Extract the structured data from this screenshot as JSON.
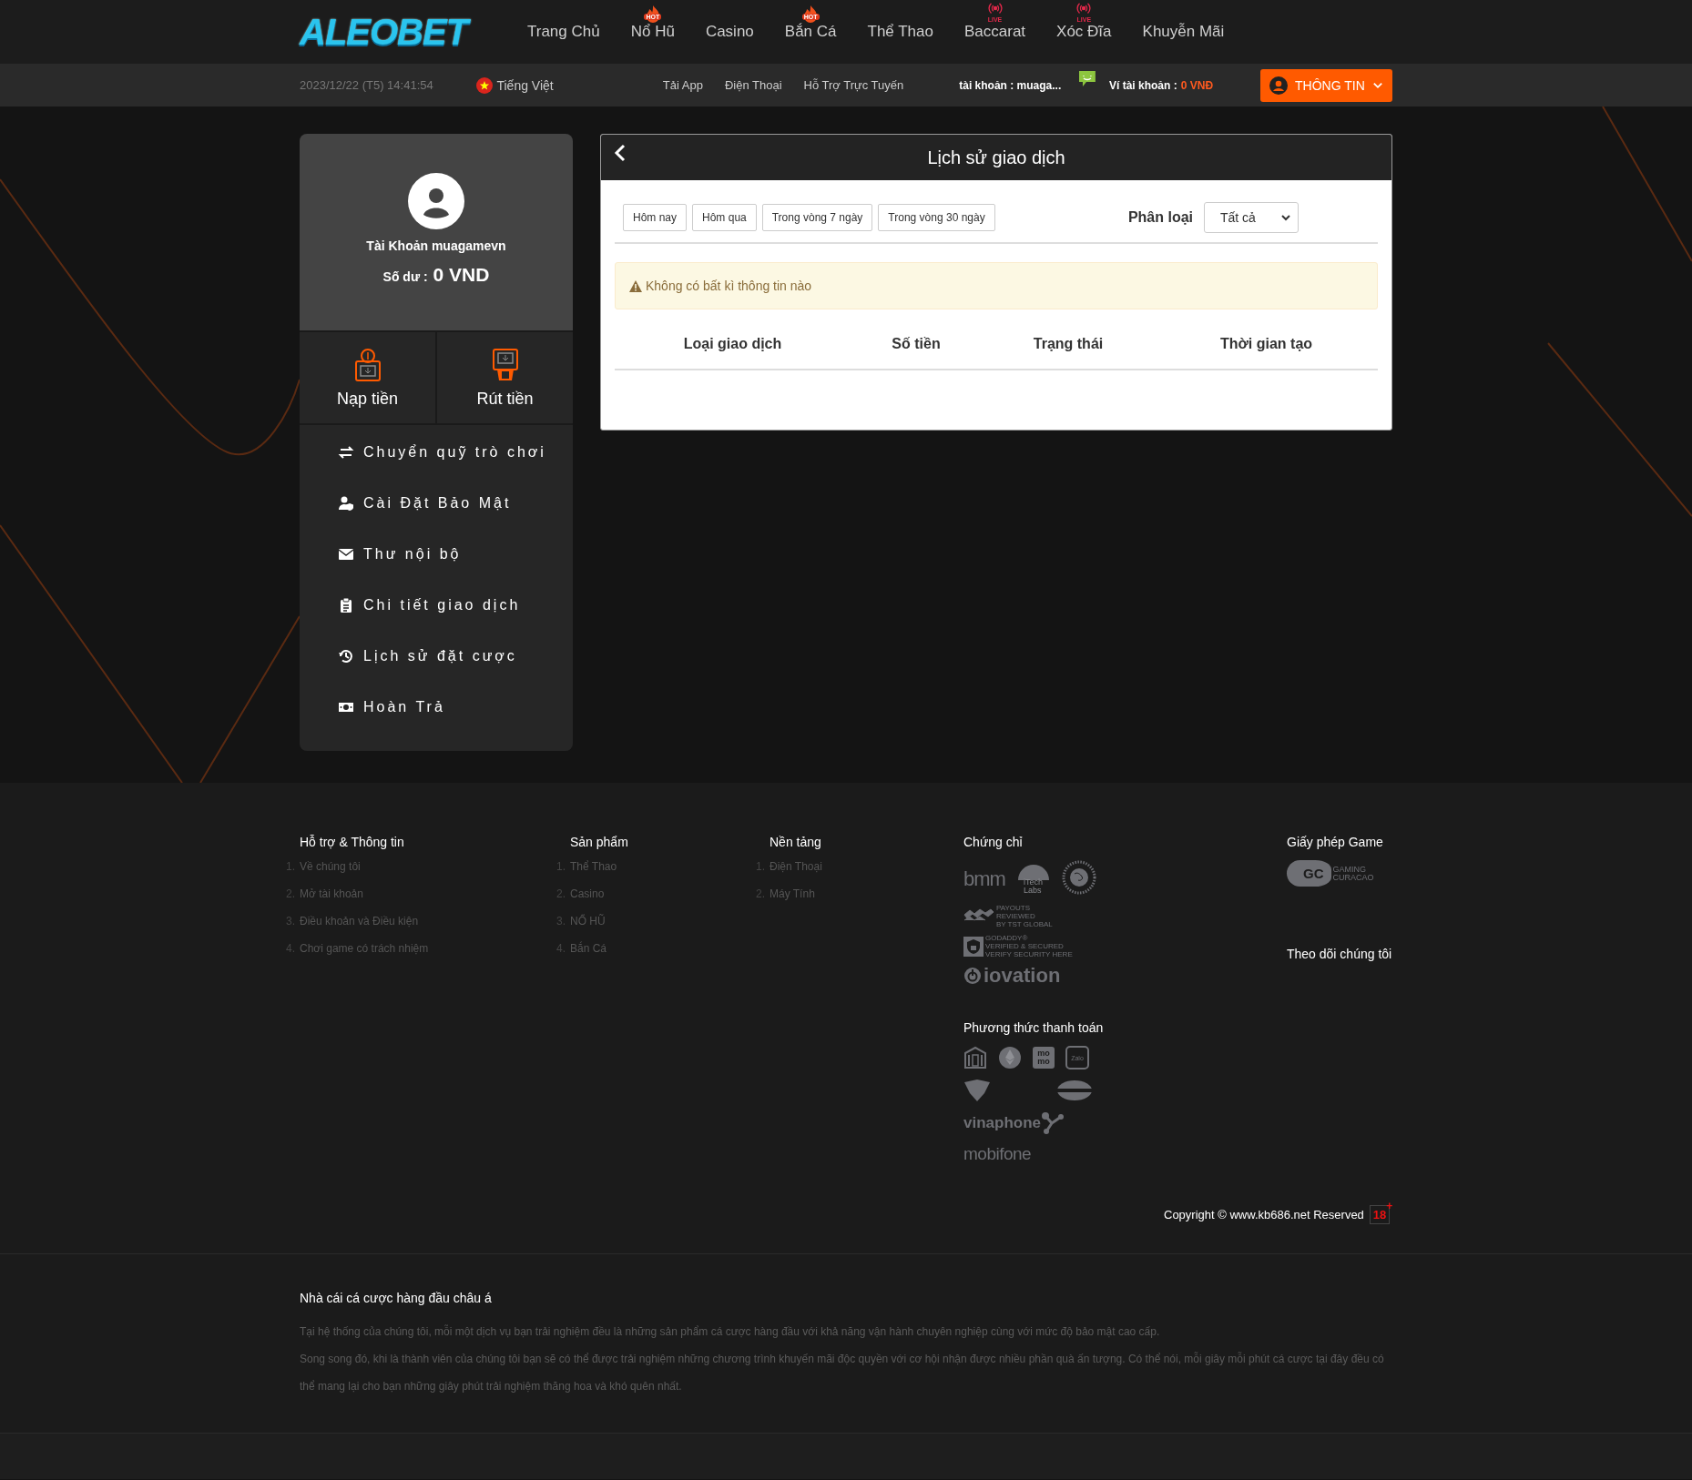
{
  "logo": {
    "text": "ALEOBET"
  },
  "nav": [
    {
      "label": "Trang Chủ"
    },
    {
      "label": "Nổ Hũ",
      "badge": {
        "kind": "hot",
        "text": "HOT"
      }
    },
    {
      "label": "Casino"
    },
    {
      "label": "Bắn Cá",
      "badge": {
        "kind": "hot",
        "text": "HOT"
      }
    },
    {
      "label": "Thể Thao"
    },
    {
      "label": "Baccarat",
      "badge": {
        "kind": "live",
        "text": "LIVE"
      }
    },
    {
      "label": "Xóc Đĩa",
      "badge": {
        "kind": "live",
        "text": "LIVE"
      }
    },
    {
      "label": "Khuyễn Mãi"
    }
  ],
  "subbar": {
    "datetime": "2023/12/22 (T5) 14:41:54",
    "language": "Tiếng Việt",
    "links": [
      "Tải App",
      "Điện Thoại",
      "Hỗ Trợ Trực Tuyến"
    ],
    "account": "tài khoản : muaga...",
    "wallet_label": "Ví tài khoản :",
    "wallet_value": "0 VNĐ",
    "info_button": "THÔNG TIN"
  },
  "profile": {
    "account": "Tài Khoản muagamevn",
    "balance_label": "Số dư :",
    "balance": "0 VND"
  },
  "actions": [
    "Nạp tiền",
    "Rút tiền"
  ],
  "menu": [
    "Chuyển quỹ trò chơi",
    "Cài Đặt Bảo Mật",
    "Thư nội bộ",
    "Chi tiết giao dịch",
    "Lịch sử đặt cược",
    "Hoàn Trả"
  ],
  "panel": {
    "title": "Lịch sử giao dịch",
    "filters": [
      {
        "label": "Hôm nay",
        "selected": false
      },
      {
        "label": "Hôm qua",
        "selected": false
      },
      {
        "label": "Trong vòng 7 ngày",
        "selected": false
      },
      {
        "label": "Trong vòng 30 ngày",
        "selected": false
      }
    ],
    "category_label": "Phân loại",
    "category_value": "Tất cả",
    "alert": "Không có bất kì thông tin nào",
    "columns": [
      "Loại giao dịch",
      "Số tiền",
      "Trạng thái",
      "Thời gian tạo"
    ]
  },
  "footer": {
    "columns": [
      {
        "title": "Hỗ trợ & Thông tin",
        "items": [
          {
            "num": "1.",
            "label": "Về chúng tôi"
          },
          {
            "num": "2.",
            "label": "Mở tài khoản"
          },
          {
            "num": "3.",
            "label": "Điều khoản và Điều kiện"
          },
          {
            "num": "4.",
            "label": "Chơi game có trách nhiệm"
          }
        ]
      },
      {
        "title": "Sản phẩm",
        "items": [
          {
            "num": "1.",
            "label": "Thể Thao"
          },
          {
            "num": "2.",
            "label": "Casino"
          },
          {
            "num": "3.",
            "label": "NỔ HŨ"
          },
          {
            "num": "4.",
            "label": "Bắn Cá"
          }
        ]
      },
      {
        "title": "Nền tảng",
        "items": [
          {
            "num": "1.",
            "label": "Điện Thoại"
          },
          {
            "num": "2.",
            "label": "Máy Tính"
          }
        ]
      }
    ],
    "certificates_title": "Chứng chỉ",
    "certificates": [
      {
        "kind": "wordmark",
        "text": "bmm"
      },
      {
        "kind": "badge",
        "lines": [
          "iTech",
          "Labs"
        ]
      },
      {
        "kind": "seal"
      },
      {
        "kind": "stacked",
        "lines": [
          "PAYOUTS",
          "REVIEWED",
          "BY TST GLOBAL"
        ]
      },
      {
        "kind": "lock",
        "lines": [
          "GODADDY®",
          "VERIFIED & SECURED",
          "VERIFY SECURITY HERE"
        ]
      },
      {
        "kind": "ring",
        "text": "iovation"
      }
    ],
    "payments_title": "Phương thức thanh toán",
    "payments": [
      {
        "kind": "bank"
      },
      {
        "kind": "ethereum"
      },
      {
        "kind": "momo",
        "lines": [
          "mo",
          "mo"
        ]
      },
      {
        "kind": "zalo",
        "text": "Zalo"
      },
      {
        "kind": "shield"
      },
      {
        "kind": "oval"
      },
      {
        "kind": "vinaphone",
        "text": "vinaphone"
      },
      {
        "kind": "mobifone",
        "text": "mobifone"
      }
    ],
    "license_title": "Giấy phép Game",
    "license": {
      "mark": "GC",
      "lines": [
        "GAMING",
        "CURACAO"
      ]
    },
    "follow_title": "Theo dõi chúng tôi",
    "copyright": "Copyright © www.kb686.net Reserved",
    "age": "18",
    "age_plus": "+"
  },
  "about": {
    "title": "Nhà cái cá cược hàng đầu châu á",
    "paragraphs": [
      "Tại hệ thống của chúng tôi, mỗi một dịch vụ bạn trải nghiệm đều là những sản phẩm cá cược hàng đầu với khả năng vận hành chuyên nghiệp cùng với mức độ bảo mật cao cấp.",
      "Song song đó, khi là thành viên của chúng tôi bạn sẽ có thể được trải nghiệm những chương trình khuyến mãi độc quyền với cơ hội nhận được nhiều phần quà ấn tượng. Có thể nói, mỗi giây mỗi phút cá cược tại đây đều có thể mang lại cho bạn những giây phút trải nghiệm thăng hoa và khó quên nhất."
    ]
  }
}
